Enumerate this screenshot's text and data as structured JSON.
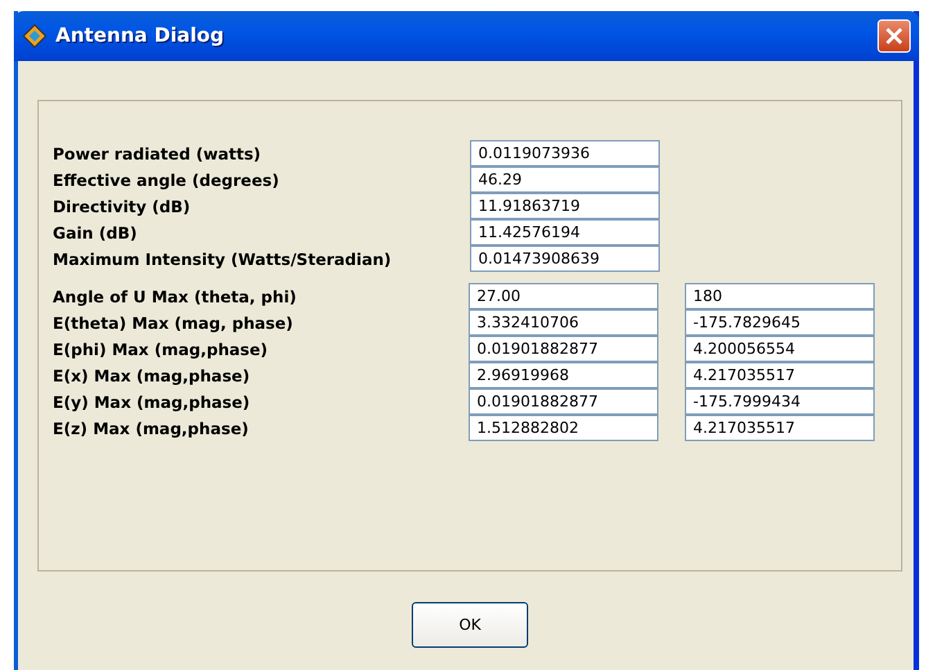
{
  "window": {
    "title": "Antenna Dialog"
  },
  "groups": [
    {
      "rows": [
        {
          "label": "Power radiated (watts)",
          "values": [
            "0.0119073936"
          ]
        },
        {
          "label": "Effective angle (degrees)",
          "values": [
            "46.29"
          ]
        },
        {
          "label": "Directivity (dB)",
          "values": [
            "11.91863719"
          ]
        },
        {
          "label": "Gain (dB)",
          "values": [
            "11.42576194"
          ]
        },
        {
          "label": "Maximum Intensity (Watts/Steradian)",
          "values": [
            "0.01473908639"
          ]
        }
      ]
    },
    {
      "rows": [
        {
          "label": "Angle of U Max (theta, phi)",
          "values": [
            "27.00",
            "180"
          ]
        },
        {
          "label": "E(theta) Max (mag, phase)",
          "values": [
            "3.332410706",
            "-175.7829645"
          ]
        },
        {
          "label": "E(phi) Max (mag,phase)",
          "values": [
            "0.01901882877",
            "4.200056554"
          ]
        },
        {
          "label": "E(x) Max (mag,phase)",
          "values": [
            "2.96919968",
            "4.217035517"
          ]
        },
        {
          "label": "E(y) Max (mag,phase)",
          "values": [
            "0.01901882877",
            "-175.7999434"
          ]
        },
        {
          "label": "E(z) Max (mag,phase)",
          "values": [
            "1.512882802",
            "4.217035517"
          ]
        }
      ]
    }
  ],
  "buttons": [
    "OK"
  ]
}
